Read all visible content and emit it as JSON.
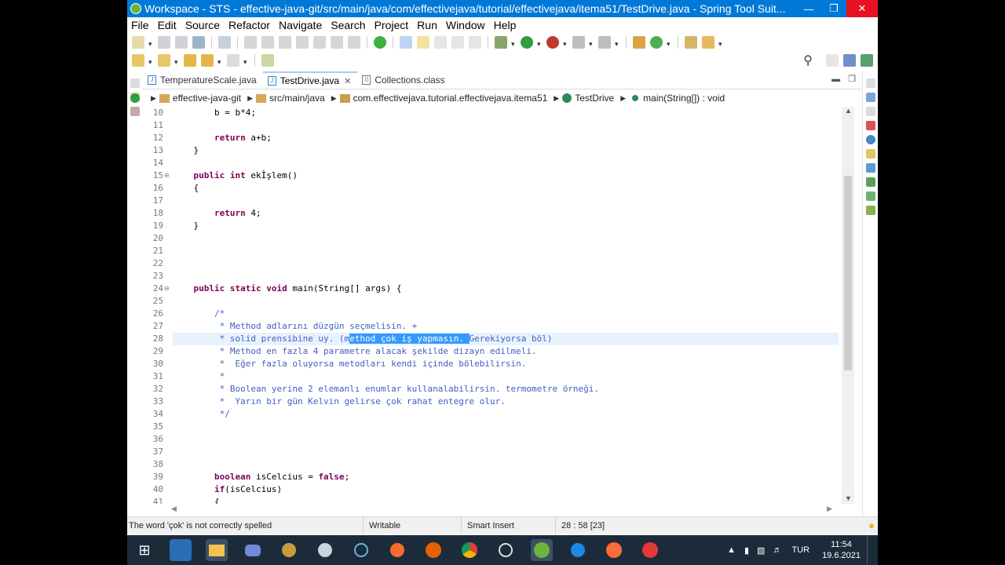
{
  "window": {
    "title": "Workspace - STS - effective-java-git/src/main/java/com/effectivejava/tutorial/effectivejava/itema51/TestDrive.java - Spring Tool Suit..."
  },
  "menu": [
    "File",
    "Edit",
    "Source",
    "Refactor",
    "Navigate",
    "Search",
    "Project",
    "Run",
    "Window",
    "Help"
  ],
  "tabs": [
    {
      "label": "TemperatureScale.java",
      "icon": "java-file-icon"
    },
    {
      "label": "TestDrive.java",
      "icon": "java-file-icon",
      "active": true
    },
    {
      "label": "Collections.class",
      "icon": "class-file-icon"
    }
  ],
  "breadcrumb": [
    "effective-java-git",
    "src/main/java",
    "com.effectivejava.tutorial.effectivejava.itema51",
    "TestDrive",
    "main(String[]) : void"
  ],
  "code": {
    "lines": [
      {
        "n": "10",
        "t": "        b = b*4;"
      },
      {
        "n": "11",
        "t": ""
      },
      {
        "n": "12",
        "t": "        return a+b;"
      },
      {
        "n": "13",
        "t": "    }"
      },
      {
        "n": "14",
        "t": ""
      },
      {
        "n": "15",
        "t": "    public int ekİşlem()"
      },
      {
        "n": "16",
        "t": "    {"
      },
      {
        "n": "17",
        "t": ""
      },
      {
        "n": "18",
        "t": "        return 4;"
      },
      {
        "n": "19",
        "t": "    }"
      },
      {
        "n": "20",
        "t": ""
      },
      {
        "n": "21",
        "t": ""
      },
      {
        "n": "22",
        "t": ""
      },
      {
        "n": "23",
        "t": ""
      },
      {
        "n": "24",
        "t": "    public static void main(String[] args) {"
      },
      {
        "n": "25",
        "t": ""
      },
      {
        "n": "26",
        "t": "        /*"
      },
      {
        "n": "27",
        "t": "         * Method adlarını düzgün seçmelisin. +"
      },
      {
        "n": "28",
        "t": "         * solid prensibine uy. (method çok iş yapmasın. Gerekiyorsa böl)"
      },
      {
        "n": "29",
        "t": "         * Method en fazla 4 parametre alacak şekilde dizayn edilmeli."
      },
      {
        "n": "30",
        "t": "         *  Eğer fazla oluyorsa metodları kendi içinde bölebilirsin."
      },
      {
        "n": "31",
        "t": "         *"
      },
      {
        "n": "32",
        "t": "         * Boolean yerine 2 elemanlı enumlar kullanalabilirsin. termometre örneği."
      },
      {
        "n": "33",
        "t": "         *  Yarın bir gün Kelvin gelirse çok rahat entegre olur."
      },
      {
        "n": "34",
        "t": "         */"
      },
      {
        "n": "35",
        "t": ""
      },
      {
        "n": "36",
        "t": ""
      },
      {
        "n": "37",
        "t": ""
      },
      {
        "n": "38",
        "t": ""
      },
      {
        "n": "39",
        "t": "        boolean isCelcius = false;"
      },
      {
        "n": "40",
        "t": "        if(isCelcius)"
      },
      {
        "n": "41",
        "t": "        {"
      }
    ],
    "selection": {
      "line": "28",
      "text": "ethod çok iş yapmasın. "
    }
  },
  "status": {
    "message": "The word 'çok' is not correctly spelled",
    "mode": "Writable",
    "insert": "Smart Insert",
    "position": "28 : 58 [23]"
  },
  "tray": {
    "language": "TUR",
    "time": "11:54",
    "date": "19.6.2021"
  },
  "colors": {
    "titlebar": "#0078d7",
    "keyword": "#7f0055",
    "comment": "#3f5fbf",
    "selection": "#3399ff",
    "taskbar": "#1c2b3a"
  }
}
